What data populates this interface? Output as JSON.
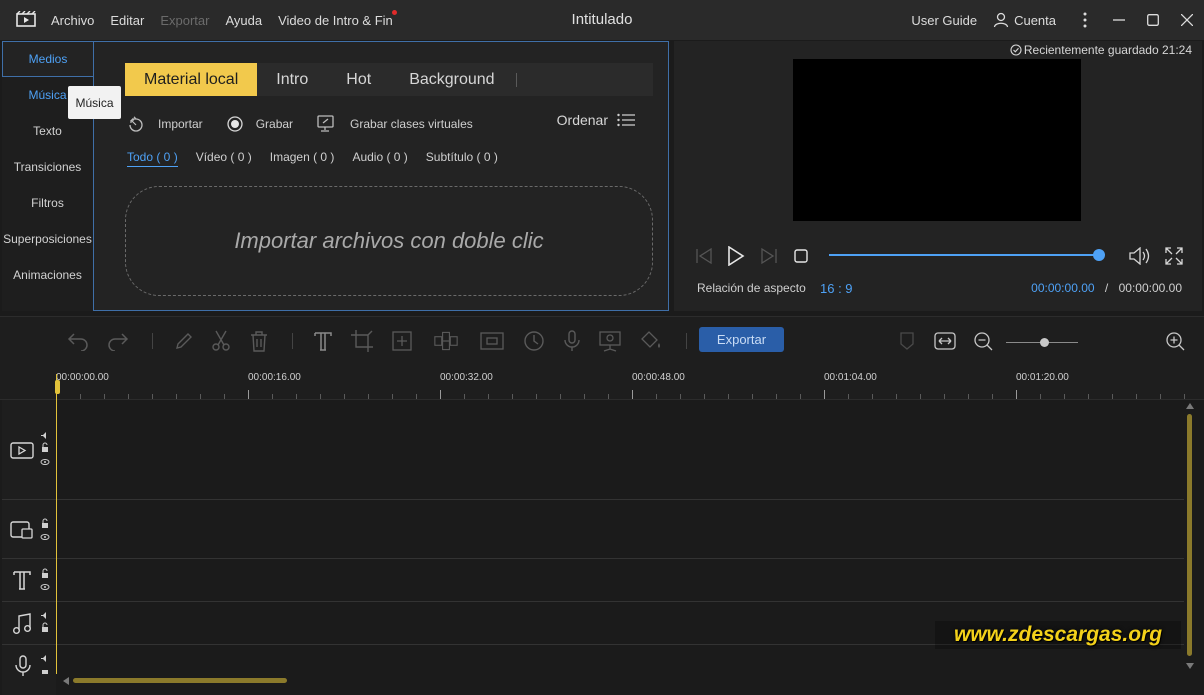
{
  "titlebar": {
    "menu": [
      "Archivo",
      "Editar",
      "Exportar",
      "Ayuda",
      "Video de Intro & Fin"
    ],
    "title": "Intitulado",
    "user_guide": "User Guide",
    "account": "Cuenta"
  },
  "sidebar": {
    "items": [
      "Medios",
      "Música",
      "Texto",
      "Transiciones",
      "Filtros",
      "Superposiciones",
      "Animaciones"
    ],
    "tooltip": "Música"
  },
  "media": {
    "tabs": [
      "Material local",
      "Intro",
      "Hot",
      "Background"
    ],
    "actions": [
      "Importar",
      "Grabar",
      "Grabar clases virtuales"
    ],
    "sort": "Ordenar",
    "filters": [
      "Todo ( 0 )",
      "Vídeo ( 0 )",
      "Imagen ( 0 )",
      "Audio ( 0 )",
      "Subtítulo ( 0 )"
    ],
    "dropzone": "Importar archivos con doble clic"
  },
  "preview": {
    "saved": "Recientemente guardado 21:24",
    "aspect_label": "Relación de aspecto",
    "aspect_value": "16 : 9",
    "current_time": "00:00:00.00",
    "separator": "/",
    "total_time": "00:00:00.00",
    "progress": 1.0
  },
  "toolbar": {
    "export": "Exportar",
    "zoom_level": 0.5
  },
  "ruler": {
    "labels": [
      "00:00:00.00",
      "00:00:16.00",
      "00:00:32.00",
      "00:00:48.00",
      "00:01:04.00",
      "00:01:20.00"
    ]
  },
  "watermark": "www.zdescargas.org",
  "colors": {
    "accent": "#4ea1f5",
    "active_tab": "#f2c94c",
    "export_button": "#2a5ea8",
    "playhead": "#e2c23a"
  }
}
